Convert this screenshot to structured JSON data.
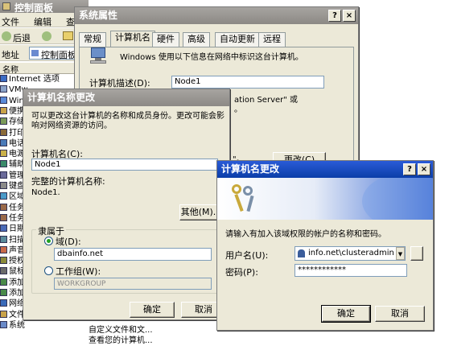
{
  "control_panel": {
    "title": "控制面板",
    "menu": [
      "文件",
      "编辑",
      "查"
    ],
    "toolbar_back": "后退",
    "address_label": "地址",
    "address_value": "控制面板",
    "column_name": "名称",
    "items": [
      "Internet 选项",
      "VMw",
      "Wind",
      "便携",
      "存储",
      "打印",
      "电话",
      "电源",
      "辅助",
      "管理",
      "键盘",
      "区域",
      "任务",
      "任务",
      "日期",
      "扫描",
      "声音",
      "授权",
      "鼠标",
      "添加",
      "添加",
      "网络",
      "文件夹选项",
      "系统"
    ],
    "items_right": [
      "自定义文件和文...",
      "查看您的计算机..."
    ]
  },
  "sys_props": {
    "title": "系统属性",
    "tabs": [
      "常规",
      "计算机名",
      "硬件",
      "高级",
      "自动更新",
      "远程"
    ],
    "description": "Windows 使用以下信息在网络中标识这台计算机。",
    "comp_desc_label": "计算机描述(D):",
    "comp_desc_value": "Node1",
    "server_text": "ation Server\" 或",
    "server_text2": "。",
    "quote_text": "\"。",
    "change_button": "更改(C)"
  },
  "name_change": {
    "title": "计算机名称更改",
    "intro": "可以更改这台计算机的名称和成员身份。更改可能会影响对网络资源的访问。",
    "computer_name_label": "计算机名(C):",
    "computer_name_value": "Node1",
    "full_name_label": "完整的计算机名称:",
    "full_name_value": "Node1.",
    "other_button": "其他(M)...",
    "member_of_label": "隶属于",
    "domain_label": "域(D):",
    "domain_value": "dbainfo.net",
    "workgroup_label": "工作组(W):",
    "workgroup_value": "WORKGROUP",
    "ok_button": "确定",
    "cancel_button": "取消"
  },
  "cred": {
    "title": "计算机名更改",
    "prompt": "请输入有加入该域权限的帐户的名称和密码。",
    "username_label": "用户名(U):",
    "username_value": "info.net\\clusteradmin",
    "password_label": "密码(P):",
    "password_value": "************",
    "ok_button": "确定",
    "cancel_button": "取消"
  },
  "colors": {
    "title_blue": "#0b3ea8",
    "title_grey": "#8c8985",
    "dialog_bg": "#ece9d8"
  }
}
